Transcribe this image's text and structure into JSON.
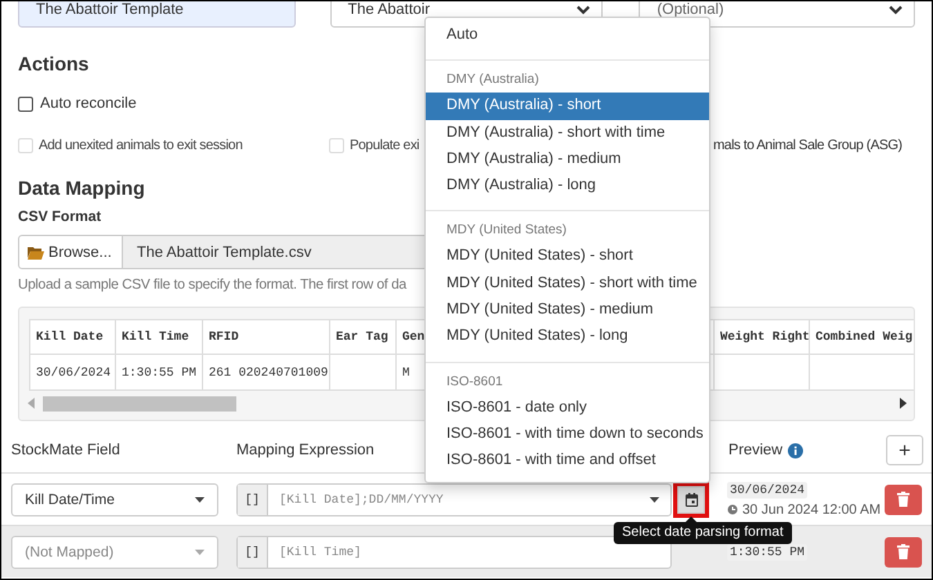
{
  "top_fields": {
    "template_name": {
      "value": "The Abattoir Template"
    },
    "abattoir_select": {
      "value": "The Abattoir"
    },
    "optional_select": {
      "placeholder": "(Optional)"
    }
  },
  "actions": {
    "title": "Actions",
    "rows": [
      [
        {
          "label": "Auto reconcile",
          "checked": false,
          "disabled": false
        }
      ],
      [
        {
          "label": "Add unexited animals to exit session",
          "checked": false,
          "disabled": true
        },
        {
          "label": "Populate exi",
          "checked": false,
          "disabled": true,
          "label_tail": "mals to Animal Sale Group (ASG)"
        }
      ]
    ]
  },
  "data_mapping": {
    "title": "Data Mapping",
    "csv_label": "CSV Format",
    "browse_button": "Browse...",
    "file_name": "The Abattoir Template.csv",
    "help": "Upload a sample CSV file to specify the format. The first row of da",
    "preview_table": {
      "columns": [
        "Kill Date",
        "Kill Time",
        "RFID",
        "Ear Tag",
        "Gen",
        "Weight Right",
        "Combined Weig"
      ],
      "rows": [
        [
          "30/06/2024",
          "1:30:55 PM",
          "261 020240701009",
          null,
          "M",
          null,
          null
        ]
      ]
    }
  },
  "mapping": {
    "columns": [
      "StockMate Field",
      "Mapping Expression",
      "Preview"
    ],
    "add_button": "+",
    "rows": [
      {
        "field": "Kill Date/Time",
        "mapped": true,
        "addon": "[]",
        "expression": "[Kill Date];DD/MM/YYYY",
        "date_button": true,
        "highlighted": true,
        "preview": "30/06/2024",
        "parsed": "30 Jun 2024 12:00 AM"
      },
      {
        "field": "(Not Mapped)",
        "mapped": false,
        "addon": "[]",
        "expression": "[Kill Time]",
        "date_button": false,
        "highlighted": false,
        "preview": "1:30:55 PM"
      }
    ]
  },
  "date_format_menu": {
    "items": [
      {
        "kind": "option",
        "label": "Auto",
        "selected": false
      },
      {
        "kind": "divider"
      },
      {
        "kind": "header",
        "label": "DMY (Australia)"
      },
      {
        "kind": "option",
        "label": "DMY (Australia) - short",
        "selected": true
      },
      {
        "kind": "option",
        "label": "DMY (Australia) - short with time",
        "selected": false
      },
      {
        "kind": "option",
        "label": "DMY (Australia) - medium",
        "selected": false
      },
      {
        "kind": "option",
        "label": "DMY (Australia) - long",
        "selected": false
      },
      {
        "kind": "divider"
      },
      {
        "kind": "header",
        "label": "MDY (United States)"
      },
      {
        "kind": "option",
        "label": "MDY (United States) - short",
        "selected": false
      },
      {
        "kind": "option",
        "label": "MDY (United States) - short with time",
        "selected": false
      },
      {
        "kind": "option",
        "label": "MDY (United States) - medium",
        "selected": false
      },
      {
        "kind": "option",
        "label": "MDY (United States) - long",
        "selected": false
      },
      {
        "kind": "divider"
      },
      {
        "kind": "header",
        "label": "ISO-8601"
      },
      {
        "kind": "option",
        "label": "ISO-8601 - date only",
        "selected": false
      },
      {
        "kind": "option",
        "label": "ISO-8601 - with time down to seconds",
        "selected": false
      },
      {
        "kind": "option",
        "label": "ISO-8601 - with time and offset",
        "selected": false
      }
    ]
  },
  "tooltip": "Select date parsing format"
}
